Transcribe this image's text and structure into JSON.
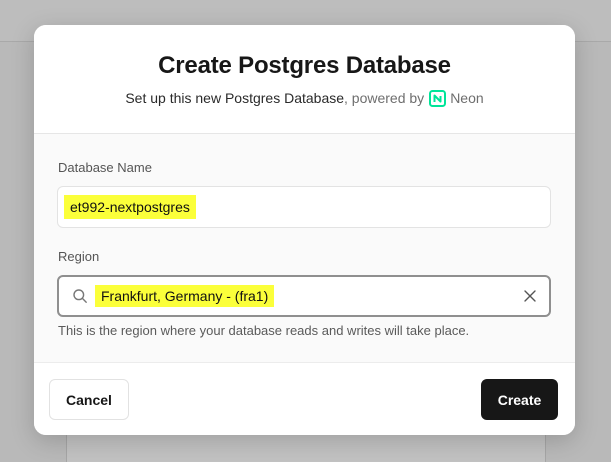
{
  "dialog": {
    "title": "Create Postgres Database",
    "subtitle_main": "Set up this new Postgres Database",
    "subtitle_powered": ", powered by",
    "provider_name": "Neon",
    "neon_logo_color": "#00e599"
  },
  "form": {
    "database_name_label": "Database Name",
    "database_name_value": "et992-nextpostgres",
    "region_label": "Region",
    "region_value": "Frankfurt, Germany - (fra1)",
    "region_hint": "This is the region where your database reads and writes will take place."
  },
  "footer": {
    "cancel_label": "Cancel",
    "create_label": "Create"
  },
  "colors": {
    "highlight": "#fbff3a",
    "primary_button": "#171717"
  }
}
